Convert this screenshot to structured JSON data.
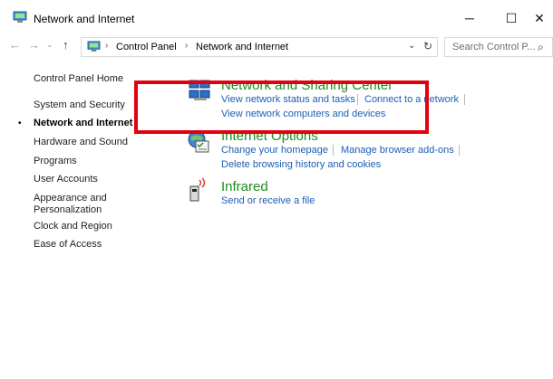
{
  "window": {
    "title": "Network and Internet"
  },
  "controls": {
    "minimize": "─",
    "maximize": "☐",
    "close": "✕"
  },
  "nav": {
    "back": "←",
    "forward": "→",
    "recent": "⌄",
    "up": "↑"
  },
  "address": {
    "crumbs": [
      "Control Panel",
      "Network and Internet"
    ],
    "separator": "›",
    "dropdown": "⌄",
    "refresh": "↻"
  },
  "search": {
    "placeholder": "Search Control P...",
    "icon": "⌕"
  },
  "left_nav": {
    "items": [
      "Control Panel Home",
      "System and Security",
      "Network and Internet",
      "Hardware and Sound",
      "Programs",
      "User Accounts",
      "Appearance and Personalization",
      "Clock and Region",
      "Ease of Access"
    ],
    "appearance_line1": "Appearance and",
    "appearance_line2": "Personalization",
    "current_index": 2,
    "bullet": "•"
  },
  "categories": {
    "network_sharing": {
      "title": "Network and Sharing Center",
      "links": [
        "View network status and tasks",
        "Connect to a network",
        "View network computers and devices"
      ]
    },
    "internet_options": {
      "title": "Internet Options",
      "links": [
        "Change your homepage",
        "Manage browser add-ons",
        "Delete browsing history and cookies"
      ]
    },
    "infrared": {
      "title": "Infrared",
      "links": [
        "Send or receive a file"
      ]
    }
  },
  "colors": {
    "category_title": "#1e8c1e",
    "link": "#1a5db5",
    "highlight": "#e3000f"
  },
  "icons": [
    "control-panel-icon",
    "network-sharing-icon",
    "internet-options-icon",
    "infrared-icon"
  ]
}
